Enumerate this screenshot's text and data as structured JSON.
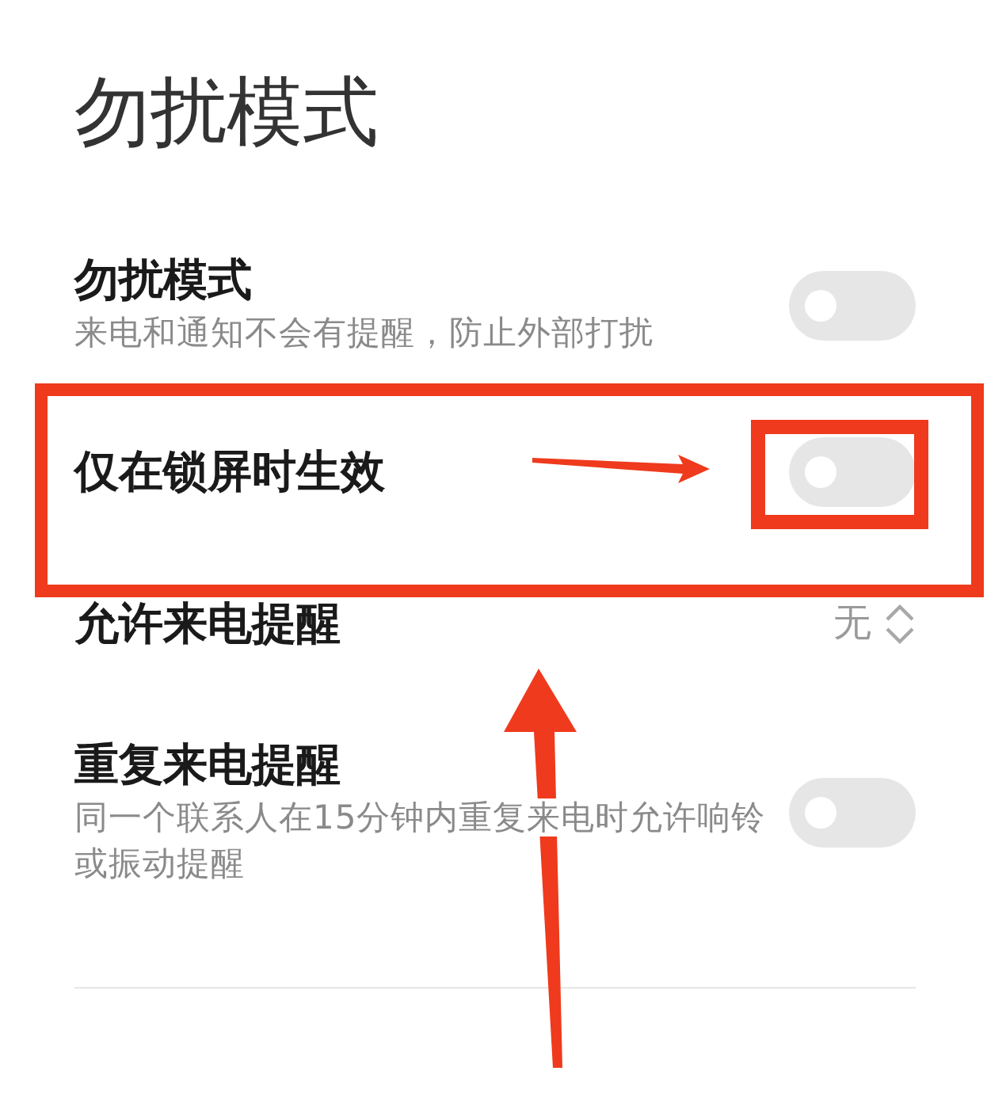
{
  "page": {
    "title": "勿扰模式"
  },
  "settings": [
    {
      "kind": "toggle",
      "title": "勿扰模式",
      "subtitle": "来电和通知不会有提醒，防止外部打扰",
      "on": false
    },
    {
      "kind": "toggle",
      "title": "仅在锁屏时生效",
      "on": false
    },
    {
      "kind": "select",
      "title": "允许来电提醒",
      "value": "无"
    },
    {
      "kind": "toggle",
      "title": "重复来电提醒",
      "subtitle": "同一个联系人在15分钟内重复来电时允许响铃或振动提醒",
      "on": false
    }
  ]
}
